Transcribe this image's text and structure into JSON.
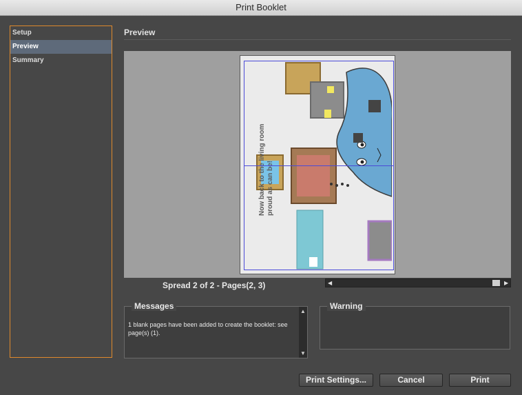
{
  "window": {
    "title": "Print Booklet"
  },
  "sidebar": {
    "items": [
      {
        "label": "Setup"
      },
      {
        "label": "Preview"
      },
      {
        "label": "Summary"
      }
    ]
  },
  "main": {
    "heading": "Preview",
    "spread_label": "Spread 2 of 2 - Pages(2, 3)",
    "preview_text": "Now back to the living room proud as can be!",
    "page_numbers": {
      "left": "2",
      "right": "3"
    }
  },
  "messages": {
    "title": "Messages",
    "text": "1 blank pages have been added to create the booklet: see page(s) (1)."
  },
  "warning": {
    "title": "Warning"
  },
  "buttons": {
    "print_settings": "Print Settings...",
    "cancel": "Cancel",
    "print": "Print"
  },
  "colors": {
    "accent": "#e08a2c",
    "selected": "#5e6a7a",
    "guides": "#4a4ad8"
  }
}
